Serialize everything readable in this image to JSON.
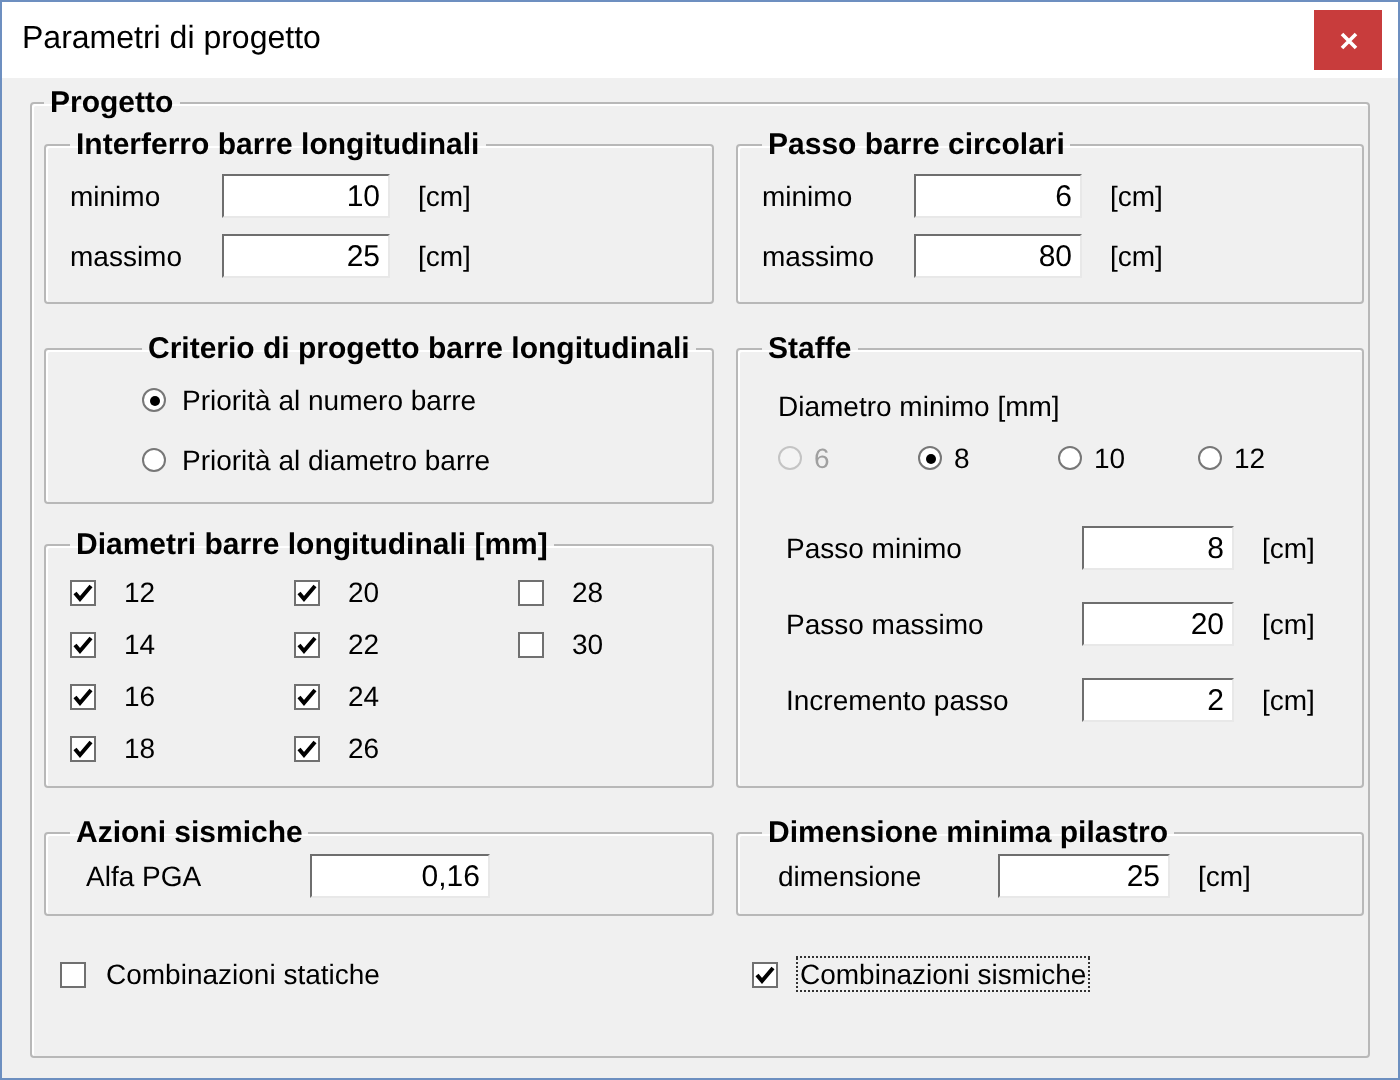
{
  "window": {
    "title": "Parametri di progetto"
  },
  "progetto": {
    "title": "Progetto",
    "interferro": {
      "title": "Interferro barre longitudinali",
      "rows": [
        {
          "label": "minimo",
          "value": "10",
          "unit": "[cm]"
        },
        {
          "label": "massimo",
          "value": "25",
          "unit": "[cm]"
        }
      ]
    },
    "passo_circolari": {
      "title": "Passo barre circolari",
      "rows": [
        {
          "label": "minimo",
          "value": "6",
          "unit": "[cm]"
        },
        {
          "label": "massimo",
          "value": "80",
          "unit": "[cm]"
        }
      ]
    },
    "criterio": {
      "title": "Criterio di progetto barre longitudinali",
      "options": [
        {
          "label": "Priorità al numero barre",
          "selected": true
        },
        {
          "label": "Priorità al diametro barre",
          "selected": false
        }
      ]
    },
    "diametri": {
      "title": "Diametri barre longitudinali [mm]",
      "columns": [
        [
          {
            "label": "12",
            "checked": true
          },
          {
            "label": "14",
            "checked": true
          },
          {
            "label": "16",
            "checked": true
          },
          {
            "label": "18",
            "checked": true
          }
        ],
        [
          {
            "label": "20",
            "checked": true
          },
          {
            "label": "22",
            "checked": true
          },
          {
            "label": "24",
            "checked": true
          },
          {
            "label": "26",
            "checked": true
          }
        ],
        [
          {
            "label": "28",
            "checked": false
          },
          {
            "label": "30",
            "checked": false
          }
        ]
      ]
    },
    "staffe": {
      "title": "Staffe",
      "diameter_label": "Diametro minimo [mm]",
      "diameters": [
        {
          "label": "6",
          "selected": false,
          "disabled": true
        },
        {
          "label": "8",
          "selected": true,
          "disabled": false
        },
        {
          "label": "10",
          "selected": false,
          "disabled": false
        },
        {
          "label": "12",
          "selected": false,
          "disabled": false
        }
      ],
      "rows": [
        {
          "label": "Passo minimo",
          "value": "8",
          "unit": "[cm]"
        },
        {
          "label": "Passo massimo",
          "value": "20",
          "unit": "[cm]"
        },
        {
          "label": "Incremento passo",
          "value": "2",
          "unit": "[cm]"
        }
      ]
    },
    "azioni": {
      "title": "Azioni sismiche",
      "label": "Alfa PGA",
      "value": "0,16"
    },
    "dimensione": {
      "title": "Dimensione minima pilastro",
      "label": "dimensione",
      "value": "25",
      "unit": "[cm]"
    },
    "options": [
      {
        "label": "Combinazioni statiche",
        "checked": false,
        "focused": false
      },
      {
        "label": "Combinazioni sismiche",
        "checked": true,
        "focused": true
      }
    ]
  }
}
